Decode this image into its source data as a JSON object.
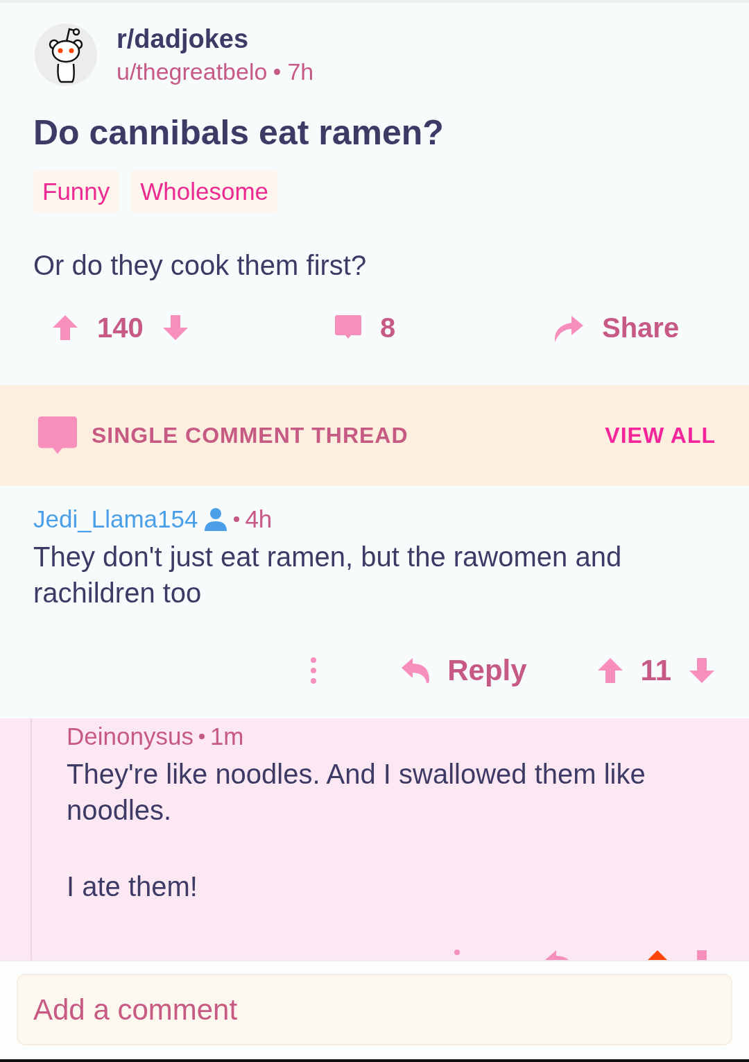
{
  "post": {
    "subreddit": "r/dadjokes",
    "author": "u/thegreatbelo",
    "time": "7h",
    "title": "Do cannibals eat ramen?",
    "flairs": [
      "Funny",
      "Wholesome"
    ],
    "body": "Or do they cook them first?",
    "score": "140",
    "comments": "8",
    "share": "Share"
  },
  "thread_banner": {
    "label": "SINGLE COMMENT THREAD",
    "link": "VIEW ALL"
  },
  "comments": [
    {
      "author": "Jedi_Llama154",
      "op": true,
      "time": "4h",
      "paragraphs": [
        "They don't just eat ramen, but the rawomen and rachildren too"
      ],
      "reply": "Reply",
      "score": "11",
      "upvoted": false,
      "nested": false
    },
    {
      "author": "Deinonysus",
      "op": false,
      "time": "1m",
      "paragraphs": [
        "They're like noodles. And I swallowed them like noodles.",
        "I ate them!"
      ],
      "upvoted": true,
      "nested": true
    }
  ],
  "composer": {
    "placeholder": "Add a comment"
  }
}
